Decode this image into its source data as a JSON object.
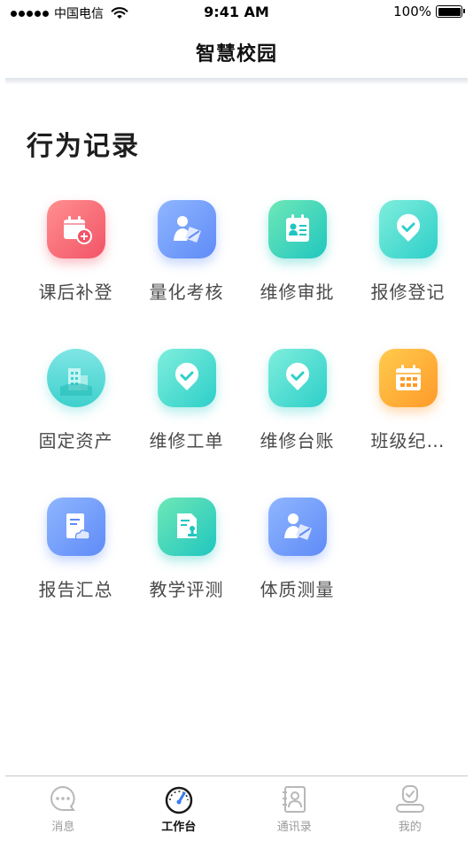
{
  "status_bar": {
    "carrier": "中国电信",
    "time": "9:41 AM",
    "battery": "100%"
  },
  "nav": {
    "title": "智慧校园"
  },
  "section": {
    "title": "行为记录"
  },
  "apps": [
    {
      "label": "课后补登",
      "icon": "calendar-add-icon",
      "color": "#f25467"
    },
    {
      "label": "量化考核",
      "icon": "person-sign-icon",
      "color": "#5f8bf7"
    },
    {
      "label": "维修审批",
      "icon": "id-card-icon",
      "color": "#20c6c0"
    },
    {
      "label": "报修登记",
      "icon": "location-check-icon",
      "color": "#2dcfc9"
    },
    {
      "label": "固定资产",
      "icon": "building-icon",
      "color": "#3fd0cc"
    },
    {
      "label": "维修工单",
      "icon": "location-check-icon",
      "color": "#2dcfc9"
    },
    {
      "label": "维修台账",
      "icon": "location-check-icon",
      "color": "#2dcfc9"
    },
    {
      "label": "班级纪…",
      "icon": "calendar-grid-icon",
      "color": "#ff9a2a"
    },
    {
      "label": "报告汇总",
      "icon": "document-cloud-icon",
      "color": "#5f8bf7"
    },
    {
      "label": "教学评测",
      "icon": "document-stamp-icon",
      "color": "#20c6c0"
    },
    {
      "label": "体质测量",
      "icon": "person-sign-icon",
      "color": "#5f8bf7"
    }
  ],
  "tabs": [
    {
      "label": "消息",
      "icon": "chat-bubble-icon",
      "active": false
    },
    {
      "label": "工作台",
      "icon": "speedometer-icon",
      "active": true
    },
    {
      "label": "通讯录",
      "icon": "contacts-icon",
      "active": false
    },
    {
      "label": "我的",
      "icon": "user-icon",
      "active": false
    }
  ]
}
